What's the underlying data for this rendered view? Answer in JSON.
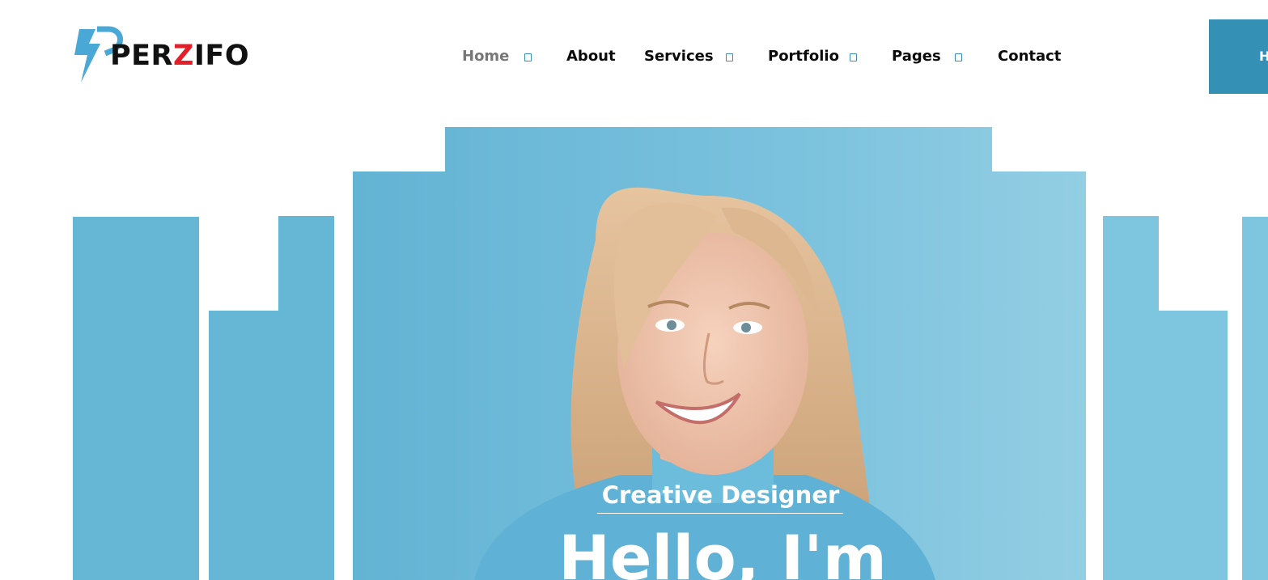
{
  "header": {
    "logo": {
      "prefix": "PER",
      "highlight": "Z",
      "suffix": "IFO"
    },
    "nav": [
      {
        "label": "Home",
        "has_dropdown": true,
        "active": true
      },
      {
        "label": "About",
        "has_dropdown": false
      },
      {
        "label": "Services",
        "has_dropdown": true
      },
      {
        "label": "Portfolio",
        "has_dropdown": true
      },
      {
        "label": "Pages",
        "has_dropdown": true
      },
      {
        "label": "Contact",
        "has_dropdown": false
      }
    ],
    "cta_label": "H"
  },
  "hero": {
    "subtitle": "Creative Designer",
    "headline": "Hello, I'm"
  },
  "colors": {
    "accent": "#3590b5",
    "panel_blue": "#66b6d5",
    "logo_red": "#e3202a",
    "logo_blue": "#4aa8d6",
    "text_dark": "#0a0a0a",
    "nav_active": "#777777"
  },
  "icons": {
    "dropdown": "chevron-down-icon"
  }
}
